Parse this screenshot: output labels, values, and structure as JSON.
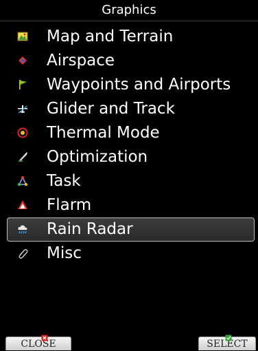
{
  "window": {
    "title": "Graphics"
  },
  "menu": {
    "items": [
      {
        "label": "Map and Terrain",
        "icon": "map-terrain-icon"
      },
      {
        "label": "Airspace",
        "icon": "airspace-icon"
      },
      {
        "label": "Waypoints and Airports",
        "icon": "waypoint-flag-icon"
      },
      {
        "label": "Glider and Track",
        "icon": "glider-icon"
      },
      {
        "label": "Thermal Mode",
        "icon": "thermal-icon"
      },
      {
        "label": "Optimization",
        "icon": "optimization-icon"
      },
      {
        "label": "Task",
        "icon": "task-icon"
      },
      {
        "label": "Flarm",
        "icon": "flarm-icon"
      },
      {
        "label": "Rain Radar",
        "icon": "rain-cloud-icon",
        "selected": true
      },
      {
        "label": "Misc",
        "icon": "paperclip-icon"
      }
    ]
  },
  "buttons": {
    "close": {
      "label": "CLOSE",
      "icon": "close-x-icon"
    },
    "select": {
      "label": "SELECT",
      "icon": "check-icon"
    }
  },
  "colors": {
    "background": "#000000",
    "text": "#ffffff",
    "selection_border": "#bdbdbd",
    "button_face": "#e6e6e6"
  }
}
